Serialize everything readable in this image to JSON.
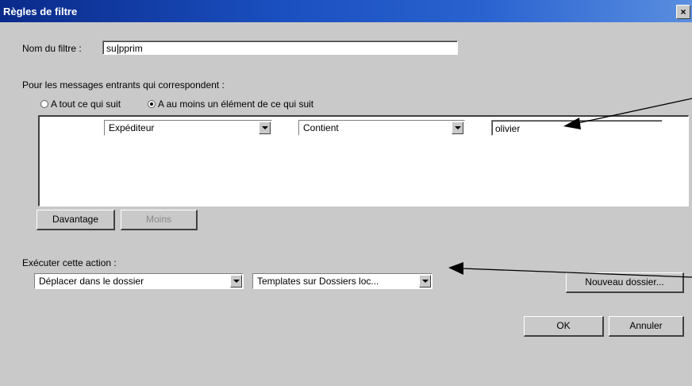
{
  "window": {
    "title": "Règles de filtre",
    "close_glyph": "×"
  },
  "filter_name": {
    "label": "Nom du filtre :",
    "value_before": "su",
    "value_after": "pprim"
  },
  "match": {
    "heading": "Pour les messages entrants qui correspondent :",
    "option_all": "A tout ce qui suit",
    "option_any": "A au moins un élément de ce qui suit",
    "selected": "any"
  },
  "rule": {
    "field": "Expéditeur",
    "operator": "Contient",
    "value": "olivier"
  },
  "rule_buttons": {
    "more": "Davantage",
    "less": "Moins"
  },
  "action": {
    "heading": "Exécuter cette action :",
    "action_select": "Déplacer dans le dossier",
    "folder_select": "Templates sur Dossiers loc...",
    "new_folder": "Nouveau dossier..."
  },
  "footer": {
    "ok": "OK",
    "cancel": "Annuler"
  }
}
